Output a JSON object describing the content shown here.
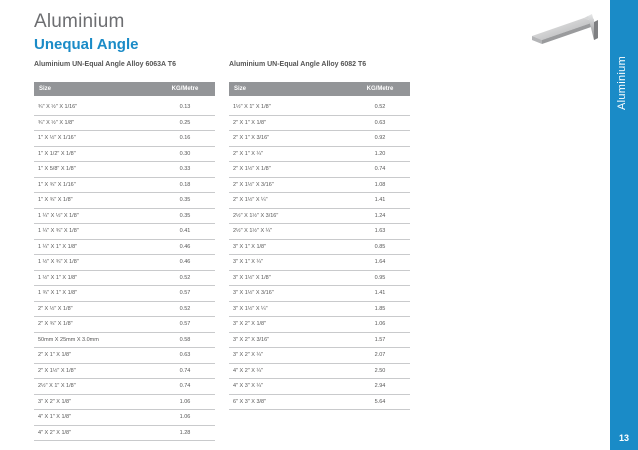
{
  "header": {
    "title": "Aluminium",
    "subtitle": "Unequal Angle"
  },
  "side_band": {
    "label": "Aluminium",
    "page_number": "13"
  },
  "tables": {
    "left": {
      "heading": "Aluminium UN-Equal Angle Alloy 6063A T6",
      "columns": [
        "Size",
        "KG/Metre"
      ],
      "rows": [
        [
          "¾\" X ½\" X 1/16\"",
          "0.13"
        ],
        [
          "¾\" X ½\" X 1/8\"",
          "0.25"
        ],
        [
          "1\" X ½\" X 1/16\"",
          "0.16"
        ],
        [
          "1\" X 1/2\" X 1/8\"",
          "0.30"
        ],
        [
          "1\" X 5/8\" X 1/8\"",
          "0.33"
        ],
        [
          "1\" X ¾\" X 1/16\"",
          "0.18"
        ],
        [
          "1\" X ¾\" X 1/8\"",
          "0.35"
        ],
        [
          "1 ¼\" X ½\" X 1/8\"",
          "0.35"
        ],
        [
          "1 ¼\" X ¾\" X 1/8\"",
          "0.41"
        ],
        [
          "1 ¼\" X 1\" X 1/8\"",
          "0.46"
        ],
        [
          "1 ½\" X ¾\" X 1/8\"",
          "0.46"
        ],
        [
          "1 ½\" X 1\" X 1/8\"",
          "0.52"
        ],
        [
          "1 ¾\" X 1\" X 1/8\"",
          "0.57"
        ],
        [
          "2\" X ½\" X 1/8\"",
          "0.52"
        ],
        [
          "2\" X ¾\" X 1/8\"",
          "0.57"
        ],
        [
          "50mm X 25mm X 3.0mm",
          "0.58"
        ],
        [
          "2\" X 1\" X 1/8\"",
          "0.63"
        ],
        [
          "2\" X 1½\" X 1/8\"",
          "0.74"
        ],
        [
          "2½\" X 1\" X 1/8\"",
          "0.74"
        ],
        [
          "3\" X 2\" X 1/8\"",
          "1.06"
        ],
        [
          "4\" X 1\" X 1/8\"",
          "1.06"
        ],
        [
          "4\" X 2\" X 1/8\"",
          "1.28"
        ]
      ]
    },
    "right": {
      "heading": "Aluminium UN-Equal Angle Alloy 6082 T6",
      "columns": [
        "Size",
        "KG/Metre"
      ],
      "rows": [
        [
          "1½\" X 1\" X 1/8\"",
          "0.52"
        ],
        [
          "2\" X 1\" X 1/8\"",
          "0.63"
        ],
        [
          "2\" X 1\" X 3/16\"",
          "0.92"
        ],
        [
          "2\" X 1\" X ¼\"",
          "1.20"
        ],
        [
          "2\" X 1½\" X 1/8\"",
          "0.74"
        ],
        [
          "2\" X 1½\" X 3/16\"",
          "1.08"
        ],
        [
          "2\" X 1½\" X ¼\"",
          "1.41"
        ],
        [
          "2½\" X 1½\" X 3/16\"",
          "1.24"
        ],
        [
          "2½\" X 1½\" X ¼\"",
          "1.63"
        ],
        [
          "3\" X 1\" X 1/8\"",
          "0.85"
        ],
        [
          "3\" X 1\" X ¼\"",
          "1.64"
        ],
        [
          "3\" X 1½\" X 1/8\"",
          "0.95"
        ],
        [
          "3\" X 1½\" X 3/16\"",
          "1.41"
        ],
        [
          "3\" X 1½\" X ¼\"",
          "1.85"
        ],
        [
          "3\" X 2\" X 1/8\"",
          "1.06"
        ],
        [
          "3\" X 2\" X 3/16\"",
          "1.57"
        ],
        [
          "3\" X 2\" X ¼\"",
          "2.07"
        ],
        [
          "4\" X 2\" X ¼\"",
          "2.50"
        ],
        [
          "4\" X 3\" X ¼\"",
          "2.94"
        ],
        [
          "6\" X 3\" X 3/8\"",
          "5.64"
        ]
      ]
    }
  },
  "colors": {
    "accent": "#1a8bc7",
    "header_gray": "#939598",
    "title_gray": "#6d6e71"
  },
  "icons": {
    "product_image": "aluminium-unequal-angle-icon"
  }
}
